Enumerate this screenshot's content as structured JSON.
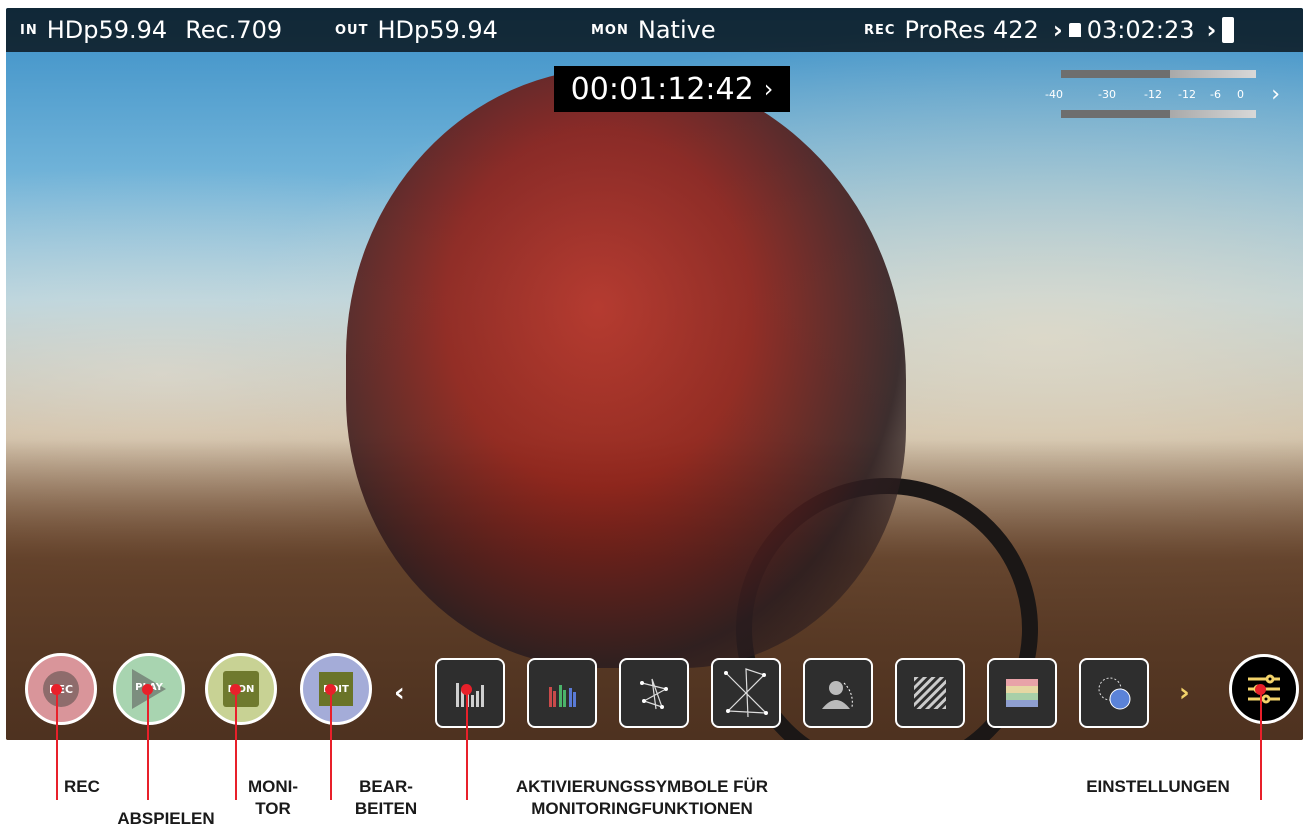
{
  "topbar": {
    "in_tag": "IN",
    "in_format": "HDp59.94",
    "in_gamut": "Rec.709",
    "out_tag": "OUT",
    "out_format": "HDp59.94",
    "mon_tag": "MON",
    "mon_value": "Native",
    "rec_tag": "REC",
    "rec_codec": "ProRes 422",
    "remaining_time": "03:02:23"
  },
  "timecode": "00:01:12:42",
  "audio_meter": {
    "labels": [
      "-40",
      "-30",
      "-12",
      "-12",
      "-6",
      "0"
    ]
  },
  "mode_buttons": [
    {
      "label": "REC",
      "color": "#d9959a"
    },
    {
      "label": "PLAY",
      "color": "#a8d4b0"
    },
    {
      "label": "MON",
      "color": "#c8d294"
    },
    {
      "label": "EDIT",
      "color": "#a4acd8"
    }
  ],
  "tools": [
    {
      "icon": "waveform-icon"
    },
    {
      "icon": "rgb-parade-icon"
    },
    {
      "icon": "vectorscope-icon"
    },
    {
      "icon": "vectorscope-zoom-icon"
    },
    {
      "icon": "focus-peaking-icon"
    },
    {
      "icon": "zebra-icon"
    },
    {
      "icon": "false-color-icon"
    },
    {
      "icon": "frame-guides-icon"
    }
  ],
  "accent_arrow_color": "#f3d36a",
  "callout_color": "#e8202a",
  "labels": {
    "rec": "REC",
    "play": "ABSPIELEN",
    "mon_line1": "MONI-",
    "mon_line2": "TOR",
    "edit_line1": "BEAR-",
    "edit_line2": "BEITEN",
    "tools_line1": "AKTIVIERUNGSSYMBOLE FÜR",
    "tools_line2": "MONITORINGFUNKTIONEN",
    "settings": "EINSTELLUNGEN"
  }
}
